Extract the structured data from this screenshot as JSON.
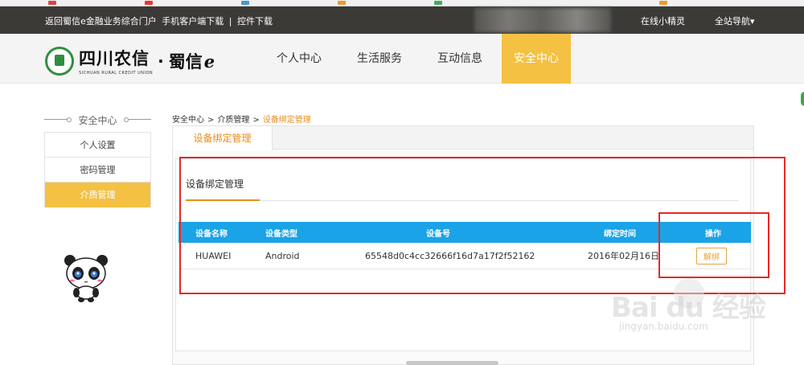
{
  "topbar": {
    "link_portal": "返回蜀信e金融业务综合门户",
    "link_mobile": "手机客户端下载",
    "separator": "|",
    "link_plugin": "控件下载",
    "online_spirit": "在线小精灵",
    "site_nav": "全站导航",
    "site_nav_arrow": "▾"
  },
  "logo": {
    "cn_name": "四川农信",
    "en_name": "SICHUAN RURAL CREDIT UNION",
    "dot": "·",
    "brand": "蜀信",
    "brand_e": "e"
  },
  "mainnav": {
    "items": [
      "个人中心",
      "生活服务",
      "互动信息",
      "安全中心"
    ],
    "active_index": 3
  },
  "sidebar": {
    "title": "安全中心",
    "items": [
      "个人设置",
      "密码管理",
      "介质管理"
    ],
    "active_index": 2
  },
  "breadcrumb": {
    "level1": "安全中心",
    "level2": "介质管理",
    "current": "设备绑定管理",
    "sep": ">"
  },
  "panel": {
    "tab_label": "设备绑定管理",
    "subtab_label": "设备绑定管理"
  },
  "table": {
    "headers": [
      "设备名称",
      "设备类型",
      "设备号",
      "绑定时间",
      "操作"
    ],
    "rows": [
      {
        "name": "HUAWEI",
        "type": "Android",
        "device_no": "65548d0c4cc32666f16d7a17f2f52162",
        "bind_time": "2016年02月16日",
        "action": "解绑"
      }
    ]
  },
  "watermark": {
    "brand": "Bai du 经验",
    "url": "jingyan.baidu.com"
  },
  "colors": {
    "accent": "#f4c142",
    "header_blue": "#1aa3e6",
    "orange": "#e88c1b",
    "annotation_red": "#e22a2a"
  }
}
